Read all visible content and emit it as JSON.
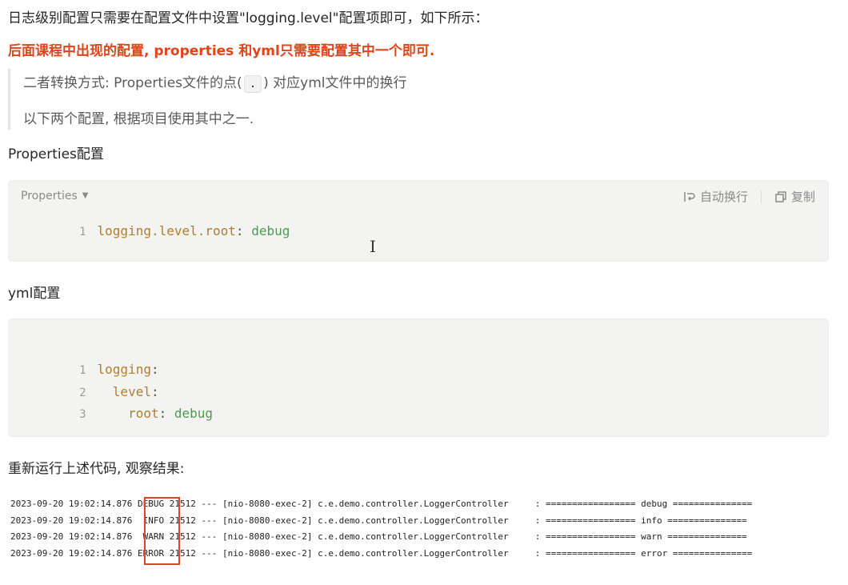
{
  "intro": "日志级别配置只需要在配置文件中设置\"logging.level\"配置项即可，如下所示：",
  "highlight": "后面课程中出现的配置, properties 和yml只需要配置其中一个即可.",
  "quote": {
    "line1_prefix": "二者转换方式: Properties文件的点(",
    "line1_code": ".",
    "line1_suffix": ") 对应yml文件中的换行",
    "line2": "以下两个配置, 根据项目使用其中之一."
  },
  "properties_heading": "Properties配置",
  "properties_block": {
    "language": "Properties",
    "wrap_label": "自动换行",
    "copy_label": "复制",
    "lines": [
      {
        "num": "1",
        "key": "logging.level.root",
        "sep": ": ",
        "value": "debug"
      }
    ]
  },
  "yml_heading": "yml配置",
  "yml_block": {
    "lines": [
      {
        "num": "1",
        "indent": "",
        "key": "logging",
        "sep": ":",
        "value": ""
      },
      {
        "num": "2",
        "indent": "  ",
        "key": "level",
        "sep": ":",
        "value": ""
      },
      {
        "num": "3",
        "indent": "    ",
        "key": "root",
        "sep": ": ",
        "value": "debug"
      }
    ]
  },
  "rerun_heading": "重新运行上述代码, 观察结果:",
  "log_lines": [
    {
      "ts": "2023-09-20 19:02:14.876",
      "level": "DEBUG",
      "pid": "21512",
      "thread": "--- [nio-8080-exec-2]",
      "logger": "c.e.demo.controller.LoggerController",
      "msg": ": ================= debug ==============="
    },
    {
      "ts": "2023-09-20 19:02:14.876",
      "level": " INFO",
      "pid": "21512",
      "thread": "--- [nio-8080-exec-2]",
      "logger": "c.e.demo.controller.LoggerController",
      "msg": ": ================= info ==============="
    },
    {
      "ts": "2023-09-20 19:02:14.876",
      "level": " WARN",
      "pid": "21512",
      "thread": "--- [nio-8080-exec-2]",
      "logger": "c.e.demo.controller.LoggerController",
      "msg": ": ================= warn ==============="
    },
    {
      "ts": "2023-09-20 19:02:14.876",
      "level": "ERROR",
      "pid": "21512",
      "thread": "--- [nio-8080-exec-2]",
      "logger": "c.e.demo.controller.LoggerController",
      "msg": ": ================= error ==============="
    }
  ],
  "colors": {
    "highlight": "#e0451a",
    "key": "#b07d2b",
    "value": "#4e9a4e",
    "level_box": "#d9472b"
  },
  "icons": [
    "wrap-icon",
    "copy-icon",
    "text-cursor-icon",
    "caret-down-icon"
  ]
}
